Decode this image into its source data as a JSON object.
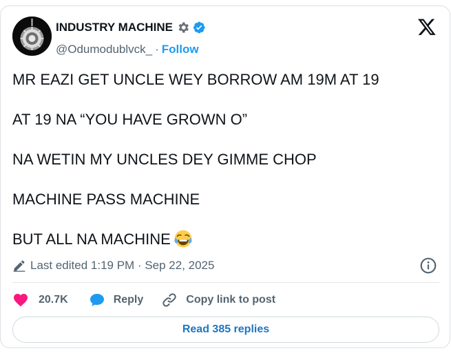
{
  "author": {
    "display_name": "INDUSTRY MACHINE",
    "handle": "@Odumodublvck_",
    "separator": "·",
    "follow_label": "Follow"
  },
  "icons": {
    "brand": "x-logo-icon",
    "name_badge": "gear-icon",
    "verified": "verified-badge-icon",
    "emoji": "face-with-tears-of-joy-emoji",
    "edited": "pencil-icon",
    "info": "info-icon",
    "like": "heart-icon",
    "reply": "speech-bubble-icon",
    "copy": "link-icon"
  },
  "tweet": {
    "lines": [
      "MR EAZI GET UNCLE WEY BORROW AM 19M AT 19",
      "AT 19 NA “YOU HAVE GROWN O”",
      "NA WETIN MY UNCLES DEY GIMME CHOP",
      "MACHINE PASS MACHINE",
      "BUT ALL NA MACHINE"
    ],
    "last_edited": "Last edited 1:19 PM · Sep 22, 2025"
  },
  "actions": {
    "likes": "20.7K",
    "reply_label": "Reply",
    "copy_label": "Copy link to post"
  },
  "read_replies_label": "Read 385 replies",
  "colors": {
    "accent": "#1d9bf0",
    "like": "#f91880",
    "muted": "#536471",
    "text": "#0f1419"
  }
}
